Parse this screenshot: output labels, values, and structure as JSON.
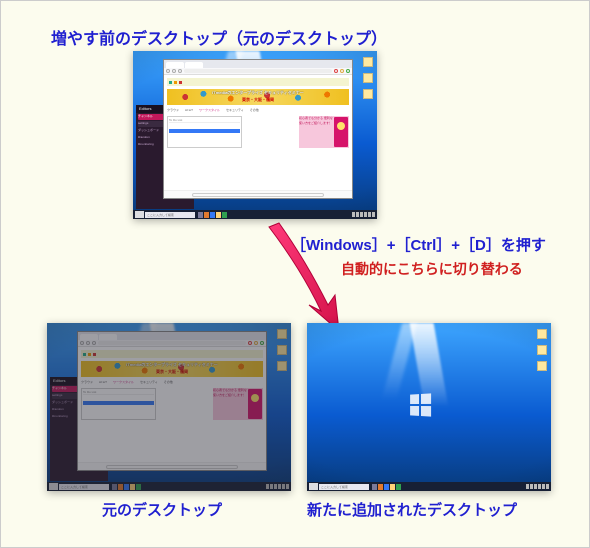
{
  "title_top": "増やす前のデスクトップ（元のデスクトップ）",
  "kbd_instruction": "［Windows］+［Ctrl］+［D］を押す",
  "auto_switch_note": "自動的にこちらに切り替わる",
  "label_bottom_left": "元のデスクトップ",
  "label_bottom_right": "新たに追加されたデスクトップ",
  "taskbar_search_placeholder": "ここに入力して検索",
  "browser": {
    "banner_line1": "ITmediaのエンタープライズ セキュリティセミナー",
    "banner_line2": "東京・大阪・福岡",
    "nav_items": [
      "クラウド",
      "AI IoT",
      "ワークスタイル",
      "セキュリティ",
      "その他"
    ],
    "card_title": "To Do List",
    "promo_text": "初心者でも分かる\n便利な使い方をご紹介します！",
    "promo_tag": ".NET TIPS"
  },
  "sideapp": {
    "title": "Editors",
    "items": [
      "チャンネル",
      "settings",
      "ダッシュボード",
      "#random",
      "#monitoring"
    ]
  }
}
